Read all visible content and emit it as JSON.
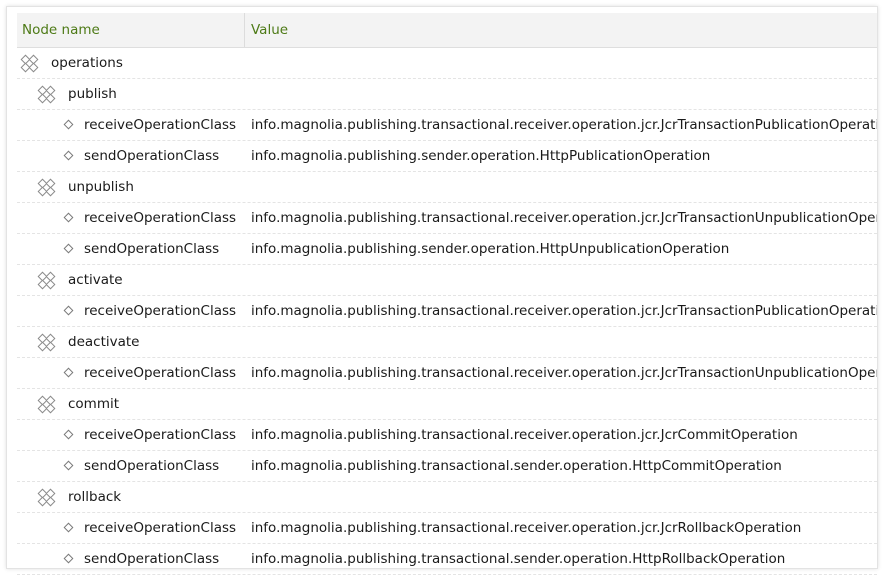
{
  "columns": {
    "name": "Node name",
    "value": "Value"
  },
  "rows": [
    {
      "type": "folder",
      "level": 0,
      "name": "operations",
      "value": ""
    },
    {
      "type": "folder",
      "level": 1,
      "name": "publish",
      "value": ""
    },
    {
      "type": "property",
      "level": 2,
      "name": "receiveOperationClass",
      "value": "info.magnolia.publishing.transactional.receiver.operation.jcr.JcrTransactionPublicationOperation"
    },
    {
      "type": "property",
      "level": 2,
      "name": "sendOperationClass",
      "value": "info.magnolia.publishing.sender.operation.HttpPublicationOperation"
    },
    {
      "type": "folder",
      "level": 1,
      "name": "unpublish",
      "value": ""
    },
    {
      "type": "property",
      "level": 2,
      "name": "receiveOperationClass",
      "value": "info.magnolia.publishing.transactional.receiver.operation.jcr.JcrTransactionUnpublicationOperation"
    },
    {
      "type": "property",
      "level": 2,
      "name": "sendOperationClass",
      "value": "info.magnolia.publishing.sender.operation.HttpUnpublicationOperation"
    },
    {
      "type": "folder",
      "level": 1,
      "name": "activate",
      "value": ""
    },
    {
      "type": "property",
      "level": 2,
      "name": "receiveOperationClass",
      "value": "info.magnolia.publishing.transactional.receiver.operation.jcr.JcrTransactionPublicationOperation"
    },
    {
      "type": "folder",
      "level": 1,
      "name": "deactivate",
      "value": ""
    },
    {
      "type": "property",
      "level": 2,
      "name": "receiveOperationClass",
      "value": "info.magnolia.publishing.transactional.receiver.operation.jcr.JcrTransactionUnpublicationOperation"
    },
    {
      "type": "folder",
      "level": 1,
      "name": "commit",
      "value": ""
    },
    {
      "type": "property",
      "level": 2,
      "name": "receiveOperationClass",
      "value": "info.magnolia.publishing.transactional.receiver.operation.jcr.JcrCommitOperation"
    },
    {
      "type": "property",
      "level": 2,
      "name": "sendOperationClass",
      "value": "info.magnolia.publishing.transactional.sender.operation.HttpCommitOperation"
    },
    {
      "type": "folder",
      "level": 1,
      "name": "rollback",
      "value": ""
    },
    {
      "type": "property",
      "level": 2,
      "name": "receiveOperationClass",
      "value": "info.magnolia.publishing.transactional.receiver.operation.jcr.JcrRollbackOperation"
    },
    {
      "type": "property",
      "level": 2,
      "name": "sendOperationClass",
      "value": "info.magnolia.publishing.transactional.sender.operation.HttpRollbackOperation"
    }
  ],
  "colors": {
    "header_text": "#4d7a16",
    "header_bg": "#f3f3f3",
    "icon": "#8a8a8a"
  },
  "icons": {
    "folder": "content-node-icon",
    "property": "property-diamond-icon"
  }
}
